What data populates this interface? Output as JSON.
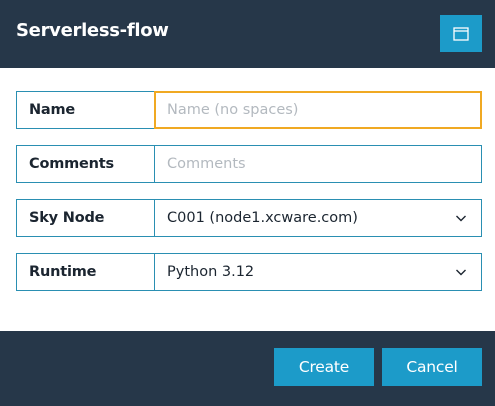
{
  "dialog": {
    "title": "Serverless-flow",
    "window_icon": "window-restore-icon"
  },
  "form": {
    "name": {
      "label": "Name",
      "value": "",
      "placeholder": "Name (no spaces)"
    },
    "comments": {
      "label": "Comments",
      "value": "",
      "placeholder": "Comments"
    },
    "sky_node": {
      "label": "Sky Node",
      "selected": "C001 (node1.xcware.com)"
    },
    "runtime": {
      "label": "Runtime",
      "selected": "Python 3.12"
    }
  },
  "footer": {
    "create_label": "Create",
    "cancel_label": "Cancel"
  },
  "colors": {
    "header_bg": "#263749",
    "accent": "#1c9bc9",
    "border": "#2a8fb2",
    "focus": "#f0a923"
  }
}
